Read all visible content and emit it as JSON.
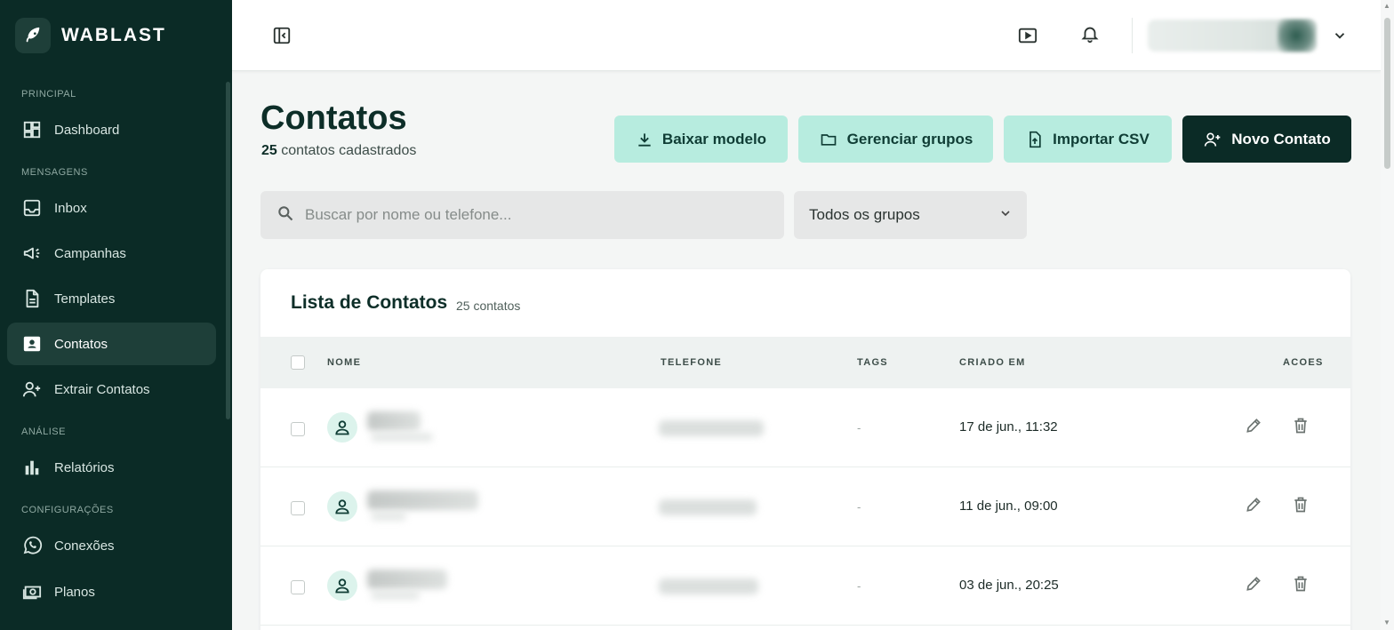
{
  "brand": {
    "name": "WABLAST",
    "logo_icon": "rocket-icon"
  },
  "sidebar": {
    "sections": [
      {
        "label": "PRINCIPAL"
      },
      {
        "label": "MENSAGENS"
      },
      {
        "label": "ANÁLISE"
      },
      {
        "label": "CONFIGURAÇÕES"
      }
    ],
    "items": [
      {
        "label": "Dashboard",
        "icon": "dashboard-icon"
      },
      {
        "label": "Inbox",
        "icon": "inbox-icon"
      },
      {
        "label": "Campanhas",
        "icon": "megaphone-icon"
      },
      {
        "label": "Templates",
        "icon": "document-icon"
      },
      {
        "label": "Contatos",
        "icon": "contact-card-icon",
        "active": true
      },
      {
        "label": "Extrair Contatos",
        "icon": "user-plus-icon"
      },
      {
        "label": "Relatórios",
        "icon": "bar-chart-icon"
      },
      {
        "label": "Conexões",
        "icon": "whatsapp-icon"
      },
      {
        "label": "Planos",
        "icon": "money-icon"
      }
    ]
  },
  "topbar": {
    "icons": [
      "sidebar-toggle-icon",
      "video-play-icon",
      "bell-icon",
      "chevron-down-icon"
    ]
  },
  "page": {
    "title": "Contatos",
    "subtitle_count": "25",
    "subtitle_text": " contatos cadastrados"
  },
  "actions": {
    "download_template": "Baixar modelo",
    "manage_groups": "Gerenciar grupos",
    "import_csv": "Importar CSV",
    "new_contact": "Novo Contato"
  },
  "filters": {
    "search_placeholder": "Buscar por nome ou telefone...",
    "group_selected": "Todos os grupos"
  },
  "list": {
    "title": "Lista de Contatos",
    "count": "25 contatos",
    "columns": [
      "NOME",
      "TELEFONE",
      "TAGS",
      "CRIADO EM",
      "ACOES"
    ],
    "rows": [
      {
        "tags": "-",
        "created_at": "17 de jun., 11:32"
      },
      {
        "tags": "-",
        "created_at": "11 de jun., 09:00"
      },
      {
        "tags": "-",
        "created_at": "03 de jun., 20:25"
      }
    ]
  },
  "colors": {
    "sidebar_bg": "#0b2b26",
    "accent_light": "#b7ecdf",
    "accent_dark": "#0b2b26",
    "active_item_bg": "#1e3f39"
  }
}
